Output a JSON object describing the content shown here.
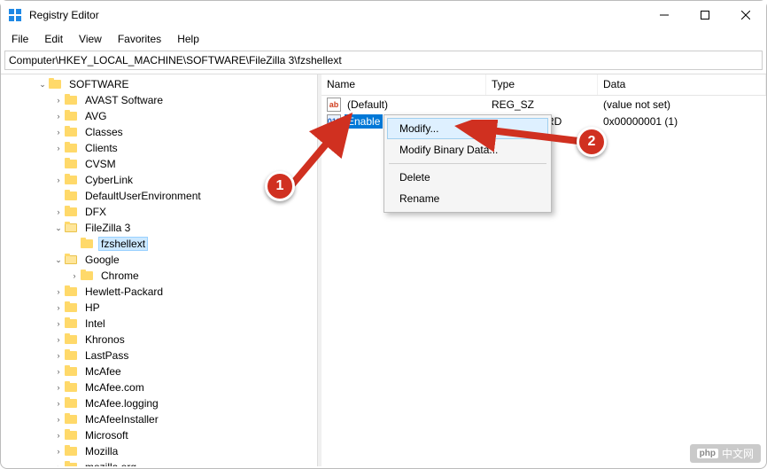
{
  "window": {
    "title": "Registry Editor"
  },
  "menu": {
    "items": [
      "File",
      "Edit",
      "View",
      "Favorites",
      "Help"
    ]
  },
  "address": "Computer\\HKEY_LOCAL_MACHINE\\SOFTWARE\\FileZilla 3\\fzshellext",
  "tree": [
    {
      "label": "SOFTWARE",
      "depth": 0,
      "expand": "open",
      "children": [
        {
          "label": "AVAST Software",
          "expand": "closed"
        },
        {
          "label": "AVG",
          "expand": "closed"
        },
        {
          "label": "Classes",
          "expand": "closed"
        },
        {
          "label": "Clients",
          "expand": "closed"
        },
        {
          "label": "CVSM",
          "expand": "none"
        },
        {
          "label": "CyberLink",
          "expand": "closed"
        },
        {
          "label": "DefaultUserEnvironment",
          "expand": "none"
        },
        {
          "label": "DFX",
          "expand": "closed"
        },
        {
          "label": "FileZilla 3",
          "expand": "open",
          "open": true,
          "children": [
            {
              "label": "fzshellext",
              "expand": "none",
              "selected": true
            }
          ]
        },
        {
          "label": "Google",
          "expand": "open",
          "open": true,
          "children": [
            {
              "label": "Chrome",
              "expand": "closed"
            }
          ]
        },
        {
          "label": "Hewlett-Packard",
          "expand": "closed"
        },
        {
          "label": "HP",
          "expand": "closed"
        },
        {
          "label": "Intel",
          "expand": "closed"
        },
        {
          "label": "Khronos",
          "expand": "closed"
        },
        {
          "label": "LastPass",
          "expand": "closed"
        },
        {
          "label": "McAfee",
          "expand": "closed"
        },
        {
          "label": "McAfee.com",
          "expand": "closed"
        },
        {
          "label": "McAfee.logging",
          "expand": "closed"
        },
        {
          "label": "McAfeeInstaller",
          "expand": "closed"
        },
        {
          "label": "Microsoft",
          "expand": "closed"
        },
        {
          "label": "Mozilla",
          "expand": "closed"
        },
        {
          "label": "mozilla.org",
          "expand": "closed"
        }
      ]
    }
  ],
  "list": {
    "columns": {
      "name": "Name",
      "type": "Type",
      "data": "Data"
    },
    "rows": [
      {
        "icon": "sz",
        "name": "(Default)",
        "type": "REG_SZ",
        "data": "(value not set)",
        "selected": false
      },
      {
        "icon": "dw",
        "name": "Enable",
        "type": "REG_DWORD",
        "data": "0x00000001 (1)",
        "selected": true
      }
    ]
  },
  "context_menu": {
    "items": [
      {
        "label": "Modify...",
        "highlight": true
      },
      {
        "label": "Modify Binary Data..."
      },
      {
        "sep": true
      },
      {
        "label": "Delete"
      },
      {
        "label": "Rename"
      }
    ]
  },
  "annotations": {
    "badge1": "1",
    "badge2": "2"
  },
  "watermark": {
    "brand": "php",
    "text": "中文网"
  }
}
